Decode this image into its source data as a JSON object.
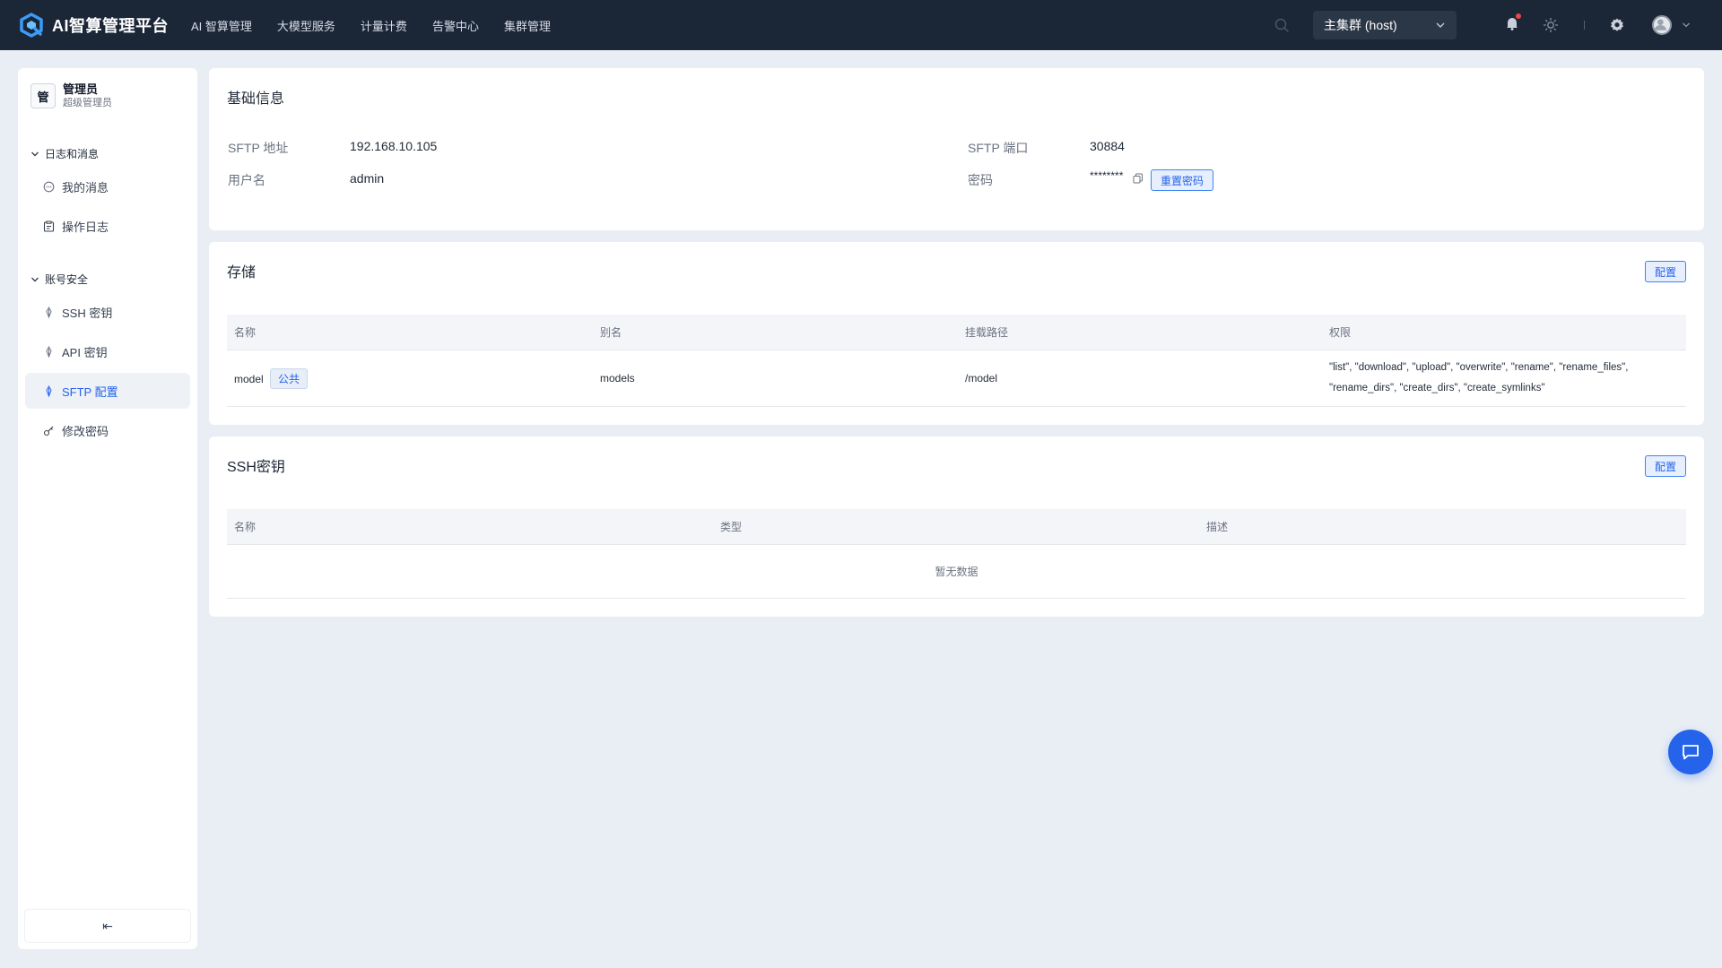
{
  "header": {
    "brand": "AI智算管理平台",
    "nav": [
      "AI 智算管理",
      "大模型服务",
      "计量计费",
      "告警中心",
      "集群管理"
    ],
    "cluster": "主集群 (host)"
  },
  "sidebar": {
    "user_avatar": "管",
    "user_name": "管理员",
    "user_role": "超级管理员",
    "groups": [
      {
        "title": "日志和消息",
        "items": [
          "我的消息",
          "操作日志"
        ]
      },
      {
        "title": "账号安全",
        "items": [
          "SSH 密钥",
          "API 密钥",
          "SFTP 配置",
          "修改密码"
        ]
      }
    ],
    "active_item": "SFTP 配置",
    "collapse_label": "⇤"
  },
  "basic_info": {
    "title": "基础信息",
    "sftp_address_label": "SFTP 地址",
    "sftp_address": "192.168.10.105",
    "sftp_port_label": "SFTP 端口",
    "sftp_port": "30884",
    "username_label": "用户名",
    "username": "admin",
    "password_label": "密码",
    "password": "********",
    "reset_label": "重置密码"
  },
  "storage": {
    "title": "存储",
    "config_label": "配置",
    "columns": [
      "名称",
      "别名",
      "挂载路径",
      "权限"
    ],
    "rows": [
      {
        "name": "model",
        "tag": "公共",
        "alias": "models",
        "mount_path": "/model",
        "permissions_line1": "\"list\", \"download\", \"upload\", \"overwrite\", \"rename\", \"rename_files\",",
        "permissions_line2": "\"rename_dirs\", \"create_dirs\", \"create_symlinks\""
      }
    ]
  },
  "ssh_keys": {
    "title": "SSH密钥",
    "config_label": "配置",
    "columns": [
      "名称",
      "类型",
      "描述"
    ],
    "empty_text": "暂无数据"
  },
  "colors": {
    "topbar": "#1b2637",
    "accent": "#2563eb",
    "background": "#e9eef4"
  }
}
